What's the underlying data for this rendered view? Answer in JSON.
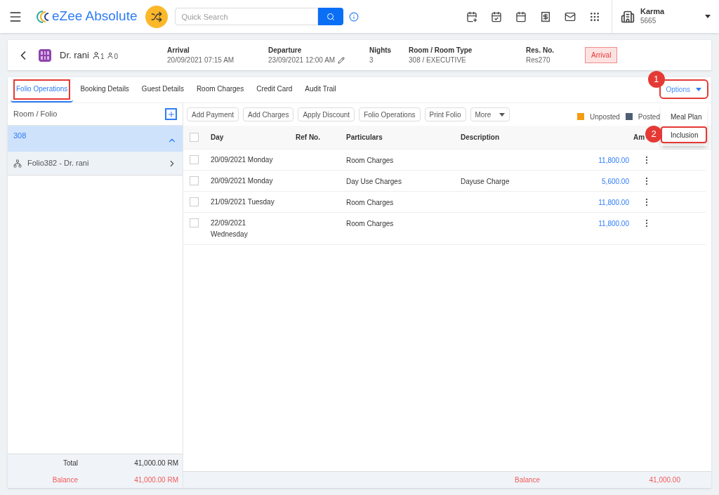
{
  "app": {
    "name": "eZee Absolute",
    "search_placeholder": "Quick Search"
  },
  "property": {
    "name": "Karma",
    "code": "5665"
  },
  "reservation": {
    "guest": "Dr. rani",
    "adults": "1",
    "children": "0",
    "arrival_label": "Arrival",
    "arrival_date": "20/09/2021",
    "arrival_time": "07:15 AM",
    "departure_label": "Departure",
    "departure_date": "23/09/2021",
    "departure_time": "12:00 AM",
    "nights_label": "Nights",
    "nights": "3",
    "room_label": "Room / Room Type",
    "room": "308 / EXECUTIVE",
    "res_label": "Res. No.",
    "res_no": "Res270",
    "status": "Arrival"
  },
  "tabs": [
    {
      "label": "Folio Operations",
      "selected": true,
      "highlighted": true
    },
    {
      "label": "Booking Details",
      "selected": false,
      "highlighted": false
    },
    {
      "label": "Guest Details",
      "selected": false,
      "highlighted": false
    },
    {
      "label": "Room Charges",
      "selected": false,
      "highlighted": false
    },
    {
      "label": "Credit Card",
      "selected": false,
      "highlighted": false
    },
    {
      "label": "Audit Trail",
      "selected": false,
      "highlighted": false
    }
  ],
  "options": {
    "label": "Options",
    "step": "1",
    "menu": [
      {
        "label": "Meal Plan",
        "highlighted": false
      },
      {
        "label": "Inclusion",
        "highlighted": true,
        "step": "2"
      }
    ]
  },
  "sidebar": {
    "title": "Room / Folio",
    "room": {
      "label": "308",
      "expanded": true
    },
    "folios": [
      {
        "label": "Folio382 - Dr. rani"
      }
    ],
    "total_label": "Total",
    "total": "41,000.00 RM",
    "balance_label": "Balance",
    "balance": "41,000.00 RM"
  },
  "toolbar": {
    "buttons": [
      "Add Payment",
      "Add Charges",
      "Apply Discount",
      "Folio Operations",
      "Print Folio"
    ],
    "more": "More"
  },
  "legend": [
    {
      "label": "Unposted",
      "color": "#f39c12"
    },
    {
      "label": "Posted",
      "color": "#4f5f73"
    }
  ],
  "table": {
    "all_checked": false,
    "columns": [
      "Day",
      "Ref No.",
      "Particulars",
      "Description",
      "Am"
    ],
    "rows": [
      {
        "day": "20/09/2021 Monday",
        "particulars": "Room Charges",
        "amount": "11,800.00",
        "checked": false
      },
      {
        "day": "20/09/2021 Monday",
        "particulars": "Day Use Charges",
        "description": "Dayuse Charge",
        "amount": "5,600.00",
        "checked": false
      },
      {
        "day": "21/09/2021 Tuesday",
        "particulars": "Room Charges",
        "amount": "11,800.00",
        "checked": false
      },
      {
        "day": "22/09/2021 Wednesday",
        "particulars": "Room Charges",
        "amount": "11,800.00",
        "checked": false
      }
    ],
    "balance_label": "Balance",
    "balance": "41,000.00"
  }
}
